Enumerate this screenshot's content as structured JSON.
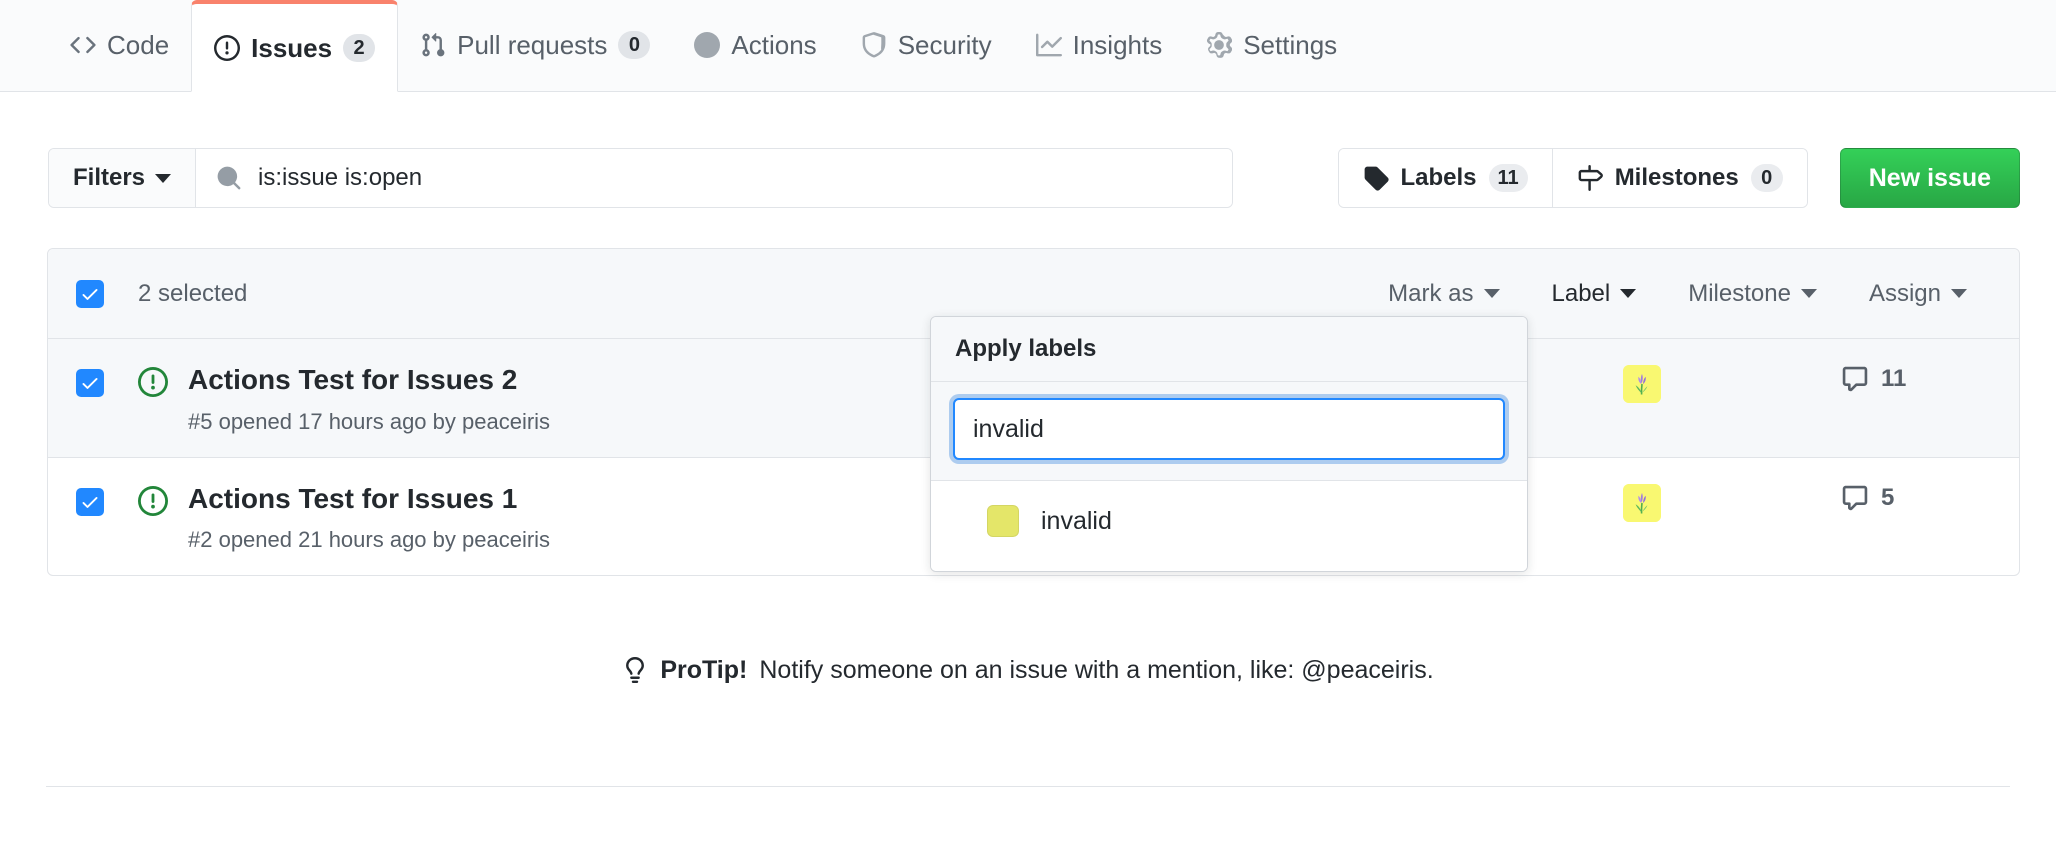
{
  "repo_nav": {
    "tabs": [
      {
        "id": "code",
        "label": "Code",
        "icon": "code-icon",
        "count": null,
        "selected": false
      },
      {
        "id": "issues",
        "label": "Issues",
        "icon": "issue-opened-icon",
        "count": "2",
        "selected": true
      },
      {
        "id": "pull-requests",
        "label": "Pull requests",
        "icon": "git-pull-request-icon",
        "count": "0",
        "selected": false
      },
      {
        "id": "actions",
        "label": "Actions",
        "icon": "play-icon",
        "count": null,
        "selected": false
      },
      {
        "id": "security",
        "label": "Security",
        "icon": "shield-icon",
        "count": null,
        "selected": false
      },
      {
        "id": "insights",
        "label": "Insights",
        "icon": "graph-icon",
        "count": null,
        "selected": false
      },
      {
        "id": "settings",
        "label": "Settings",
        "icon": "gear-icon",
        "count": null,
        "selected": false
      }
    ],
    "selected_tab_accent": "#f9826c"
  },
  "subnav": {
    "filters_label": "Filters",
    "search": {
      "value": "is:issue is:open",
      "placeholder": "Search all issues",
      "icon": "search-icon"
    },
    "labels_button": {
      "label": "Labels",
      "count": "11",
      "icon": "tag-icon"
    },
    "milestones_button": {
      "label": "Milestones",
      "count": "0",
      "icon": "milestone-icon"
    },
    "new_issue_button": {
      "label": "New issue",
      "color": "#2ea44f"
    }
  },
  "list_header": {
    "select_all_checked": true,
    "selected_text": "2 selected",
    "actions": [
      {
        "id": "mark-as",
        "label": "Mark as",
        "active": false
      },
      {
        "id": "label",
        "label": "Label",
        "active": true
      },
      {
        "id": "milestone",
        "label": "Milestone",
        "active": false
      },
      {
        "id": "assign",
        "label": "Assign",
        "active": false
      }
    ]
  },
  "issues": [
    {
      "checked": true,
      "row_selected": true,
      "status_icon": "issue-opened-icon",
      "status_color": "#22863a",
      "title": "Actions Test for Issues 2",
      "meta": "#5 opened 17 hours ago by peaceiris",
      "avatar_name": "avatar-peaceiris",
      "avatar_bg": "#f9f871",
      "comment_count": "11",
      "comment_icon": "comment-icon"
    },
    {
      "checked": true,
      "row_selected": false,
      "status_icon": "issue-opened-icon",
      "status_color": "#22863a",
      "title": "Actions Test for Issues 1",
      "meta": "#2 opened 21 hours ago by peaceiris",
      "avatar_name": "avatar-peaceiris",
      "avatar_bg": "#f9f871",
      "comment_count": "5",
      "comment_icon": "comment-icon"
    }
  ],
  "label_menu": {
    "header": "Apply labels",
    "filter_value": "invalid",
    "filter_placeholder": "Filter labels",
    "items": [
      {
        "name": "invalid",
        "color": "#e4e669"
      }
    ]
  },
  "protip": {
    "icon": "light-bulb-icon",
    "bold": "ProTip!",
    "text": "Notify someone on an issue with a mention, like: @peaceiris."
  }
}
